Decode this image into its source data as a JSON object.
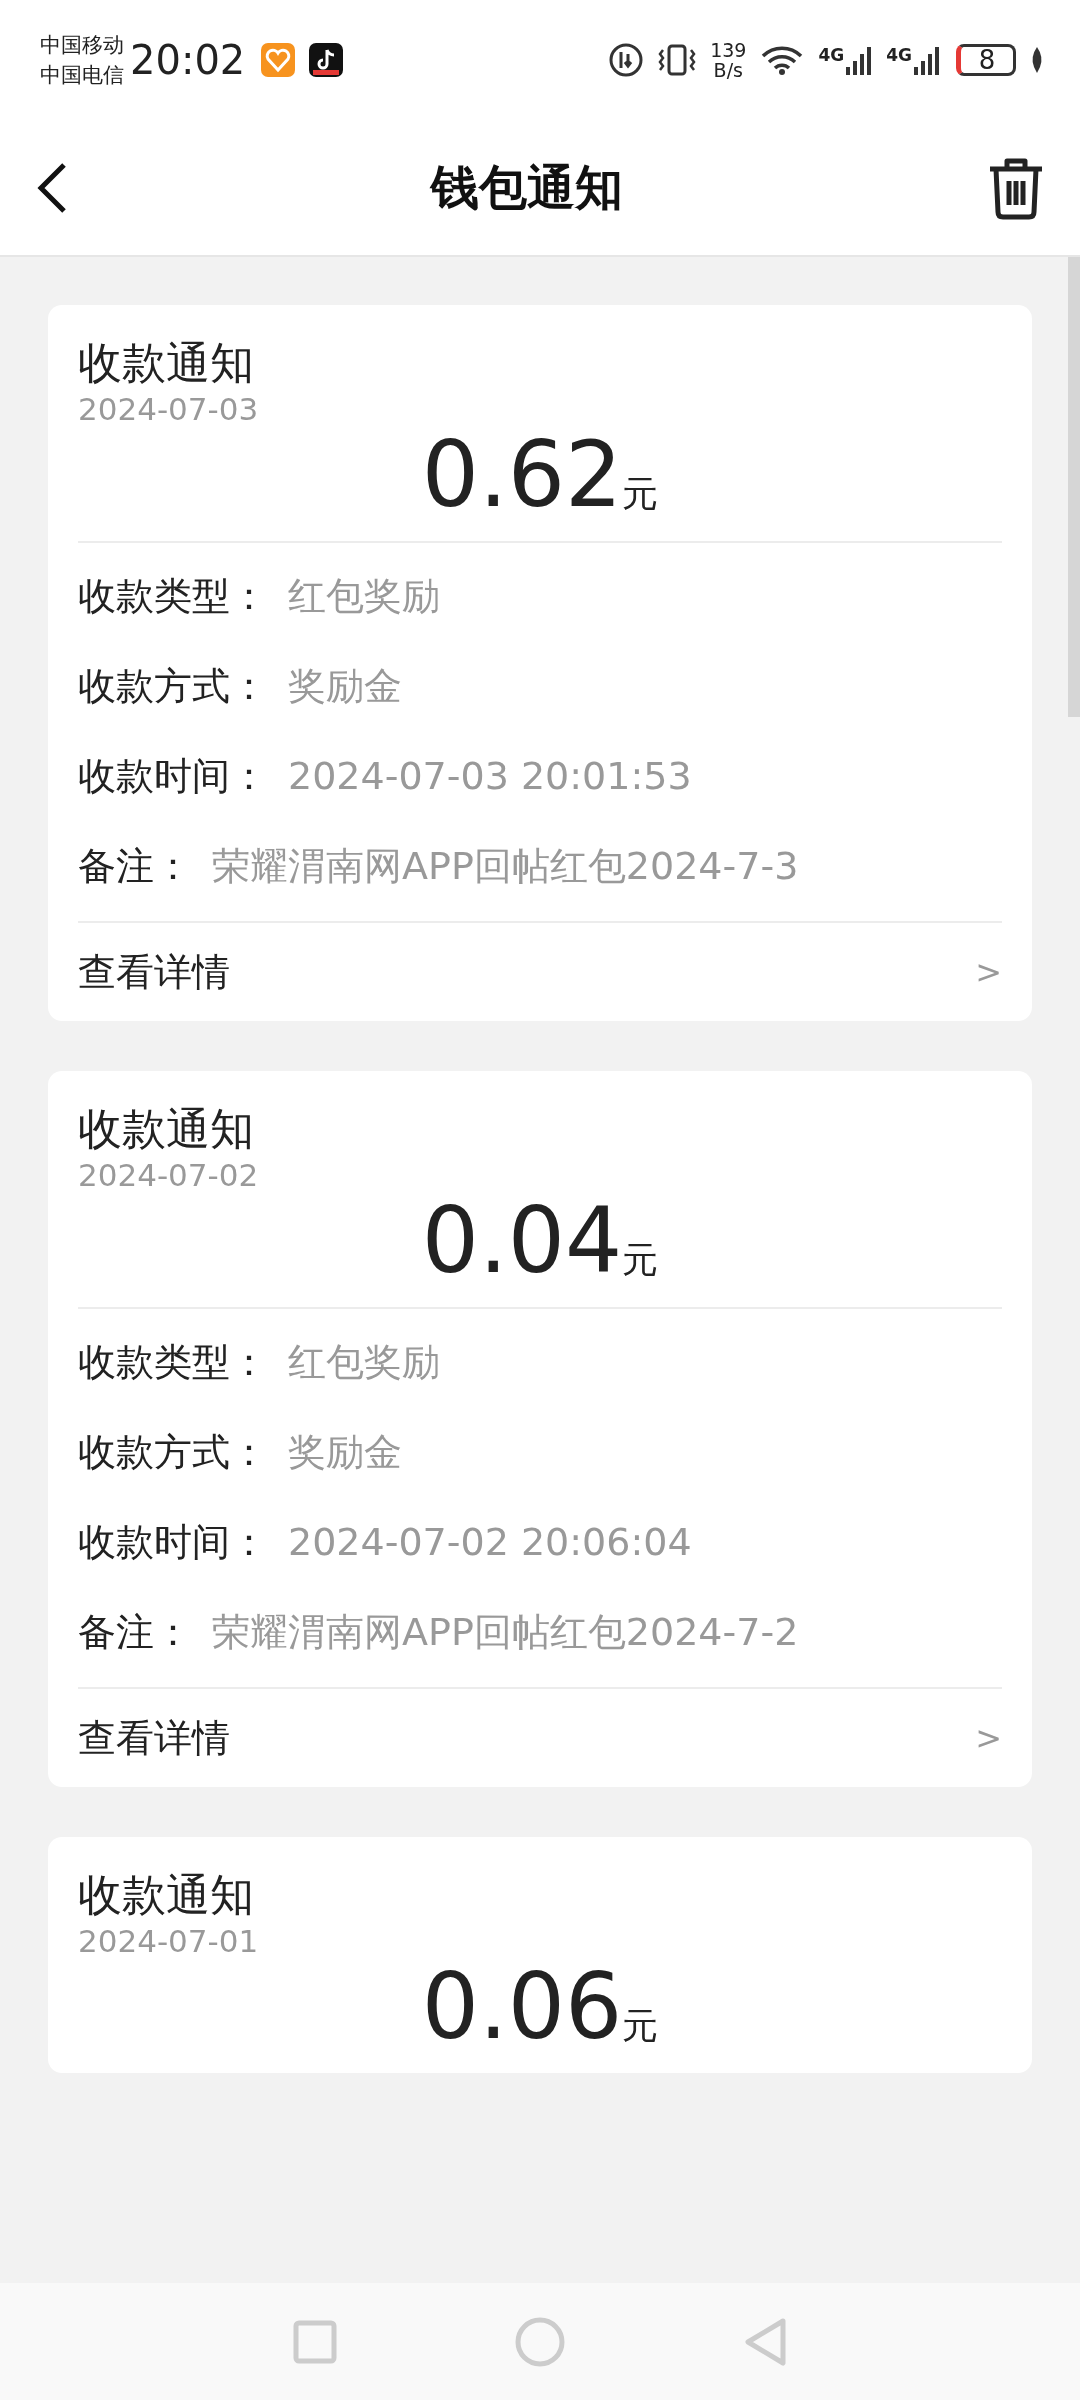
{
  "status_bar": {
    "carriers": [
      "中国移动",
      "中国电信"
    ],
    "time": "20:02",
    "net_speed": [
      "139",
      "B/s"
    ],
    "signals": [
      {
        "network": "4G"
      },
      {
        "network": "4G"
      }
    ],
    "battery": "8"
  },
  "header": {
    "title": "钱包通知"
  },
  "cards": [
    {
      "title": "收款通知",
      "date": "2024-07-03",
      "amount": "0.62",
      "unit": "元",
      "fields": [
        {
          "label": "收款类型：",
          "value": "红包奖励"
        },
        {
          "label": "收款方式：",
          "value": "奖励金"
        },
        {
          "label": "收款时间：",
          "value": "2024-07-03 20:01:53"
        },
        {
          "label": "备注：",
          "value": "荣耀渭南网APP回帖红包2024-7-3"
        }
      ],
      "link": {
        "label": "查看详情",
        "arrow": ">"
      }
    },
    {
      "title": "收款通知",
      "date": "2024-07-02",
      "amount": "0.04",
      "unit": "元",
      "fields": [
        {
          "label": "收款类型：",
          "value": "红包奖励"
        },
        {
          "label": "收款方式：",
          "value": "奖励金"
        },
        {
          "label": "收款时间：",
          "value": "2024-07-02 20:06:04"
        },
        {
          "label": "备注：",
          "value": "荣耀渭南网APP回帖红包2024-7-2"
        }
      ],
      "link": {
        "label": "查看详情",
        "arrow": ">"
      }
    },
    {
      "title": "收款通知",
      "date": "2024-07-01",
      "amount": "0.06",
      "unit": "元"
    }
  ]
}
